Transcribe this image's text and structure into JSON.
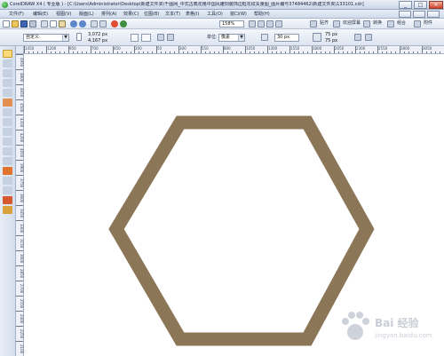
{
  "window": {
    "title": "CorelDRAW X4 ( 专业版 ) - [C:\\Users\\Administrator\\Desktop\\新建文件夹\\千图网_中式古典花格中国风雕刻装饰边框花纹矢量图_图片编号37484462\\新建文件夹\\133101.cdr]",
    "minimize_label": "_",
    "restore_label": "□",
    "close_label": "×"
  },
  "menu": {
    "items": [
      "文件(F)",
      "编辑(E)",
      "视图(V)",
      "版面(L)",
      "排列(A)",
      "效果(C)",
      "位图(B)",
      "文本(T)",
      "表格(I)",
      "工具(O)",
      "窗口(W)",
      "帮助(H)"
    ]
  },
  "standard_toolbar": {
    "zoom_value": "158%",
    "snap_label": "贴齐",
    "welcome_label": "欢迎屏幕",
    "convert_label": "转换",
    "group_label": "组合",
    "launch_label": "附件"
  },
  "property_bar": {
    "preset_value": "自定义",
    "width_value": "3,072 px",
    "height_value": "4,167 px",
    "units_label": "单位:",
    "units_value": "像素",
    "nudge_value": "30 px",
    "duplicate_x": "75 px",
    "duplicate_y": "75 px"
  },
  "rulers": {
    "top_numbers": [
      "1450",
      "1200",
      "950",
      "700",
      "450",
      "200",
      "50",
      "300",
      "550",
      "800",
      "1050",
      "1300",
      "1550",
      "1800",
      "2050",
      "2300",
      "2550",
      "2800",
      "3050"
    ],
    "left_numbers": [
      "4950",
      "4800",
      "4650",
      "4500",
      "4350",
      "4200",
      "4050",
      "3900",
      "3750",
      "3600",
      "3450",
      "3300",
      "3150",
      "3000",
      "2850",
      "2700",
      "2550",
      "2400",
      "2250",
      "2100"
    ]
  },
  "drawing": {
    "shape": "hexagon",
    "stroke_color": "#8c7658",
    "fill_color": "#ffffff"
  },
  "watermark": {
    "brand_text": "Bai 经验",
    "url_text": "jingyan.baidu.com"
  },
  "colors": {
    "chrome_light": "#e9eef7",
    "chrome_dark": "#ccd7e8",
    "tool_highlight": "#f9db7c"
  }
}
